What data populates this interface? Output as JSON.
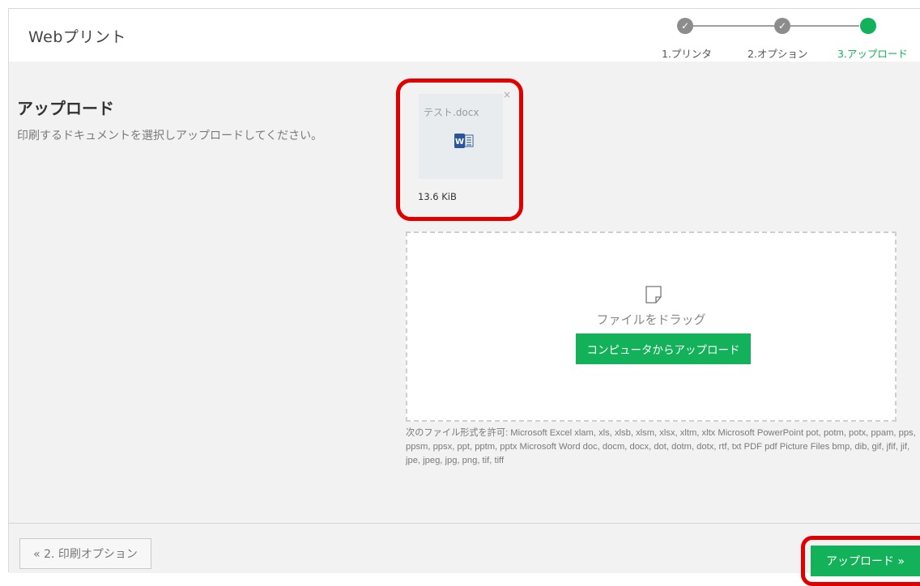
{
  "app": {
    "title": "Webプリント"
  },
  "steps": [
    {
      "label": "1.プリンタ",
      "state": "done"
    },
    {
      "label": "2.オプション",
      "state": "done"
    },
    {
      "label": "3.アップロード",
      "state": "active"
    }
  ],
  "page": {
    "heading": "アップロード",
    "description": "印刷するドキュメントを選択しアップロードしてください。"
  },
  "file": {
    "name": "テスト.docx",
    "size": "13.6 KiB",
    "close_symbol": "×",
    "icon": "word-icon"
  },
  "dropzone": {
    "text": "ファイルをドラッグ",
    "button_label": "コンピュータからアップロード",
    "icon": "document-icon"
  },
  "formats_text": "次のファイル形式を許可: Microsoft Excel xlam, xls, xlsb, xlsm, xlsx, xltm, xltx Microsoft PowerPoint pot, potm, potx, ppam, pps, ppsm, ppsx, ppt, pptm, pptx Microsoft Word doc, docm, docx, dot, dotm, dotx, rtf, txt PDF pdf Picture Files bmp, dib, gif, jfif, jif, jpe, jpeg, jpg, png, tif, tiff",
  "footer": {
    "prev_label": "« 2. 印刷オプション",
    "next_label": "アップロード »"
  },
  "colors": {
    "accent": "#13b15a",
    "highlight": "#e00000",
    "step_done": "#8c8c8c"
  }
}
